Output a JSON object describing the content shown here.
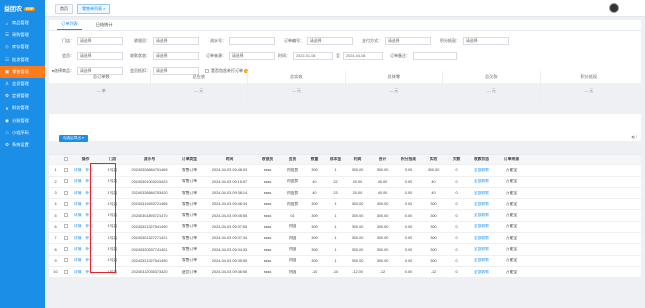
{
  "brand": {
    "name": "益团农",
    "badge": "ERP"
  },
  "sidebar": {
    "items": [
      {
        "icon": "⌂",
        "icon_name": "home-icon",
        "label": "商品管理"
      },
      {
        "icon": "☰",
        "icon_name": "purchase-icon",
        "label": "采购管理"
      },
      {
        "icon": "◇",
        "icon_name": "inventory-icon",
        "label": "库存管理"
      },
      {
        "icon": "☷",
        "icon_name": "wholesale-icon",
        "label": "批发管理"
      },
      {
        "icon": "▣",
        "icon_name": "retail-icon",
        "label": "零售管理"
      },
      {
        "icon": "♙",
        "icon_name": "member-icon",
        "label": "会员管理"
      },
      {
        "icon": "⚙",
        "icon_name": "delivery-icon",
        "label": "定损管理"
      },
      {
        "icon": "¥",
        "icon_name": "finance-icon",
        "label": "财务管理"
      },
      {
        "icon": "◉",
        "icon_name": "analytics-icon",
        "label": "分账管理"
      },
      {
        "icon": "♘",
        "icon_name": "mini-program-icon",
        "label": "小程序码"
      },
      {
        "icon": "⚙",
        "icon_name": "settings-icon",
        "label": "系统设置"
      }
    ],
    "active_index": 4
  },
  "breadcrumb": {
    "home": "首页",
    "current": "零售单列表",
    "close": "×"
  },
  "tabs": [
    {
      "label": "订单列表"
    },
    {
      "label": "日结统计"
    }
  ],
  "filters": {
    "row1": [
      {
        "label": "门店：",
        "placeholder": "请选择"
      },
      {
        "label": "收银员：",
        "placeholder": "请选择"
      },
      {
        "label": "流水号：",
        "placeholder": ""
      },
      {
        "label": "订单编号：",
        "placeholder": "请选择"
      },
      {
        "label": "支付方式：",
        "placeholder": "请选择"
      },
      {
        "label": "积分抵现：",
        "placeholder": "请选择"
      }
    ],
    "row2": [
      {
        "label": "会员：",
        "placeholder": "请选择"
      },
      {
        "label": "收款状态：",
        "placeholder": "请选择"
      },
      {
        "label": "订单来源：",
        "placeholder": "请选择"
      },
      {
        "label": "时间：",
        "placeholder": "2022-01-08",
        "to": "至",
        "end": "2024-04-08"
      },
      {
        "label": "订单备注：",
        "placeholder": ""
      }
    ],
    "row3": [
      {
        "label": "●选择商品：",
        "placeholder": "请选择"
      },
      {
        "label": "会员抵扣：",
        "placeholder": "请选择"
      },
      {
        "label": "是否包含补打订单",
        "type": "checkbox",
        "help": "?"
      }
    ]
  },
  "summary": [
    {
      "title": "总订单数",
      "value": "— 单"
    },
    {
      "title": "总应收",
      "value": "— 元"
    },
    {
      "title": "总实收",
      "value": "— 元"
    },
    {
      "title": "总抹零",
      "value": "— 元"
    },
    {
      "title": "总欠款",
      "value": "— 元"
    },
    {
      "title": "积分抵现",
      "value": "— 元"
    }
  ],
  "toolbar": {
    "action_label": "勾选后导出 ▾",
    "tool_icon": "◂) ⁝"
  },
  "table": {
    "columns": [
      "",
      "",
      "操作",
      "门店",
      "流水号",
      "订单类型",
      "时间",
      "收银员",
      "会员",
      "数量",
      "成本金",
      "利润",
      "合计",
      "积分抵现",
      "实收",
      "欠款",
      "收款状态",
      "订单来源"
    ],
    "rows": [
      [
        "1",
        "详情",
        "补打",
        "1号店",
        "20240326684751469",
        "零售订单",
        "2024-04-03 09:48:03",
        "ssss",
        "刘国良",
        "309",
        "1",
        "300.00",
        "300.00",
        "0.00",
        "300.00",
        "0",
        "全部收款",
        "万能宝"
      ],
      [
        "2",
        "详情",
        "补打",
        "1号店",
        "20240301003215423",
        "零售订单",
        "2024-04-03 09:15:57",
        "ssss",
        "刘国良",
        "40",
        "22",
        "20.00",
        "40.00",
        "0.00",
        "40",
        "0",
        "全部收款",
        "万能宝"
      ],
      [
        "3",
        "详情",
        "补打",
        "1号店",
        "20240326684753420",
        "零售订单",
        "2024-04-03 09:38:14",
        "ssss",
        "刘国良",
        "40",
        "23",
        "20.00",
        "40.00",
        "0.00",
        "40",
        "0",
        "全部收款",
        "万能宝"
      ],
      [
        "4",
        "详情",
        "补打",
        "1号店",
        "20240319453721465",
        "零售订单",
        "2024-04-03 09:46:34",
        "ssss",
        "刘国良",
        "309",
        "1",
        "300.00",
        "300.00",
        "0.00",
        "300",
        "0",
        "全部收款",
        "万能宝"
      ],
      [
        "5",
        "详情",
        "补打",
        "1号店",
        "20240301893721470",
        "零售订单",
        "2024-04-03 09:45:55",
        "ssss",
        "01",
        "309",
        "1",
        "300.00",
        "300.00",
        "0.00",
        "300",
        "0",
        "全部收款",
        "万能宝"
      ],
      [
        "6",
        "详情",
        "补打",
        "1号店",
        "20240321327541490",
        "零售订单",
        "2024-04-03 09:37:55",
        "ssss",
        "刘国",
        "309",
        "1",
        "300.00",
        "300.00",
        "0.00",
        "300",
        "0",
        "全部收款",
        "万能宝"
      ],
      [
        "7",
        "详情",
        "补打",
        "1号店",
        "20240301327271421",
        "零售订单",
        "2024-04-03 09:37:34",
        "ssss",
        "刘国",
        "309",
        "1",
        "300.00",
        "300.00",
        "0.00",
        "300",
        "0",
        "全部收款",
        "万能宝"
      ],
      [
        "8",
        "详情",
        "补打",
        "1号店",
        "20240320537741401",
        "零售订单",
        "2024-04-03 09:34:33",
        "ssss",
        "刘国",
        "309",
        "1",
        "300.00",
        "300.00",
        "0.00",
        "300",
        "0",
        "全部收款",
        "万能宝"
      ],
      [
        "9",
        "详情",
        "补打",
        "1号店",
        "20240321327541490",
        "零售订单",
        "2024-04-03 09:35:55",
        "ssss",
        "刘国",
        "309",
        "1",
        "300.00",
        "300.00",
        "0.00",
        "300",
        "0",
        "全部收款",
        "万能宝"
      ],
      [
        "10",
        "详情",
        "补打",
        "1号店",
        "20240312035373420",
        "退货订单",
        "2024-04-03 09:36:56",
        "ssss",
        "刘国",
        "-10",
        "-10",
        "-12.00",
        "-12",
        "0.00",
        "-12",
        "0",
        "全部收款",
        "万能宝"
      ]
    ]
  },
  "colors": {
    "primary": "#1b8fe8",
    "active_nav": "#ff7a1a",
    "highlight_border": "#e0262b"
  }
}
